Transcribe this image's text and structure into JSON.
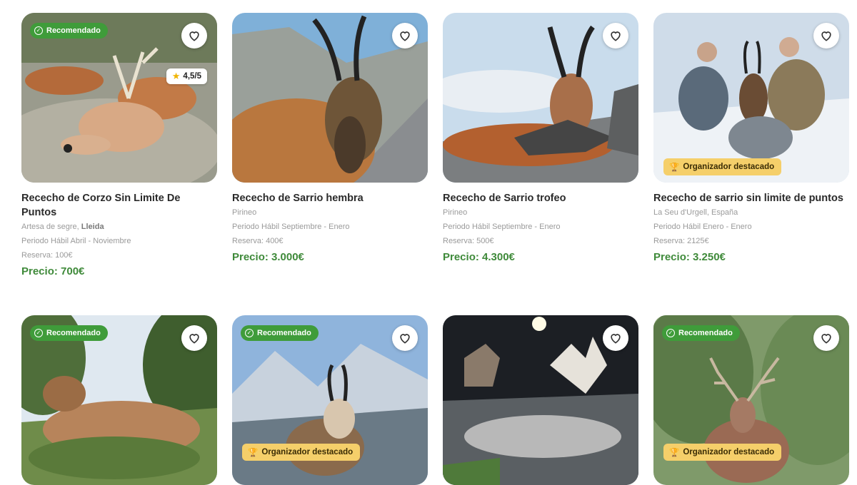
{
  "cards": [
    {
      "title": "Rececho de Corzo Sin Limite De Puntos",
      "location_prefix": "Artesa de segre, ",
      "location_bold": "Lleida",
      "period": "Periodo Hábil Abril - Noviembre",
      "reserve": "Reserva: 100€",
      "price": "Precio: 700€",
      "badge": "Recomendado",
      "rating": "4,5/5"
    },
    {
      "title": "Rececho de Sarrio hembra",
      "location": "Pirineo",
      "period": "Periodo Hábil Septiembre - Enero",
      "reserve": "Reserva: 400€",
      "price": "Precio: 3.000€"
    },
    {
      "title": "Rececho de Sarrio trofeo",
      "location": "Pirineo",
      "period": "Periodo Hábil Septiembre - Enero",
      "reserve": "Reserva: 500€",
      "price": "Precio: 4.300€"
    },
    {
      "title": "Rececho de sarrio sin limite de puntos",
      "location": "La Seu d'Urgell, España",
      "period": "Periodo Hábil Enero - Enero",
      "reserve": "Reserva: 2125€",
      "price": "Precio: 3.250€",
      "badge_org": "Organizador destacado"
    },
    {
      "badge": "Recomendado"
    },
    {
      "badge": "Recomendado",
      "badge_org": "Organizador destacado"
    },
    {},
    {
      "badge": "Recomendado",
      "badge_org": "Organizador destacado"
    }
  ],
  "colors": {
    "recommended": "#3f9c3a",
    "featured": "#f5cf6a",
    "price": "#3f8a3a"
  },
  "icons": {
    "favorite": "heart-outline-icon",
    "recommended": "check-circle-icon",
    "featured": "trophy-icon",
    "rating": "star-icon"
  }
}
